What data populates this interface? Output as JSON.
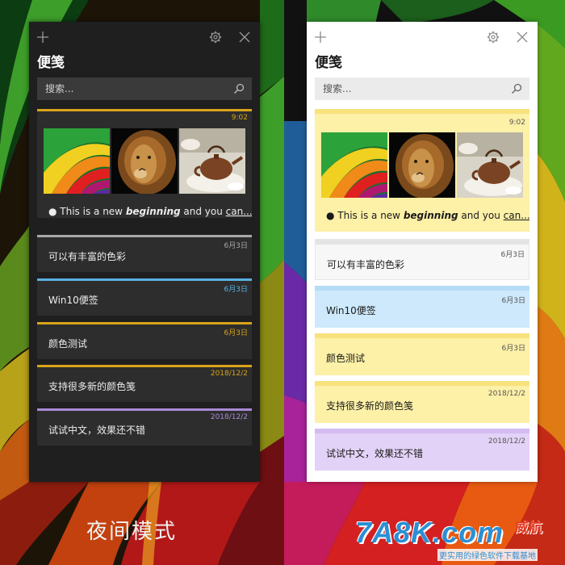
{
  "caption": "夜间模式",
  "watermark": {
    "logo": "7A8K.com",
    "brand_cn": "威航",
    "subtitle": "更实用的绿色软件下载基地"
  },
  "dark_window": {
    "title": "便笺",
    "search_placeholder": "搜索...",
    "icons": [
      "plus-icon",
      "gear-icon",
      "close-icon",
      "search-icon"
    ],
    "notes": [
      {
        "date": "9:02",
        "accent": "#d9a41a",
        "line_prefix": "● This is a new ",
        "line_bold": "beginning",
        "line_mid": " and you ",
        "line_underline": "can...",
        "images": [
          "rainbow-swirl-image",
          "lion-image",
          "teapot-image"
        ]
      },
      {
        "date": "6月3日",
        "text": "可以有丰富的色彩",
        "accent": "#a8a8a8"
      },
      {
        "date": "6月3日",
        "text": "Win10便签",
        "accent": "#5ab0e0"
      },
      {
        "date": "6月3日",
        "text": "颜色测试",
        "accent": "#d9a41a"
      },
      {
        "date": "2018/12/2",
        "text": "支持很多新的颜色笺",
        "accent": "#d9a41a"
      },
      {
        "date": "2018/12/2",
        "text": "试试中文，效果还不错",
        "accent": "#a98ad6"
      }
    ]
  },
  "light_window": {
    "title": "便笺",
    "search_placeholder": "搜索...",
    "icons": [
      "plus-icon",
      "gear-icon",
      "close-icon",
      "search-icon"
    ],
    "notes": [
      {
        "date": "9:02",
        "bg": "#fdf0a7",
        "bar": "#f7e27d",
        "line_prefix": "● This is a new ",
        "line_bold": "beginning",
        "line_mid": " and you ",
        "line_underline": "can...",
        "images": [
          "rainbow-swirl-image",
          "lion-image",
          "teapot-image"
        ]
      },
      {
        "date": "6月3日",
        "text": "可以有丰富的色彩",
        "bg": "#f7f7f7",
        "bar": "#e4e4e4"
      },
      {
        "date": "6月3日",
        "text": "Win10便签",
        "bg": "#cde9fb",
        "bar": "#b6ddf6"
      },
      {
        "date": "6月3日",
        "text": "颜色测试",
        "bg": "#fdf0a7",
        "bar": "#f7e27d"
      },
      {
        "date": "2018/12/2",
        "text": "支持很多新的颜色笺",
        "bg": "#fdf0a7",
        "bar": "#f7e27d"
      },
      {
        "date": "2018/12/2",
        "text": "试试中文，效果还不错",
        "bg": "#e3d2f7",
        "bar": "#d2bcf0"
      }
    ]
  }
}
